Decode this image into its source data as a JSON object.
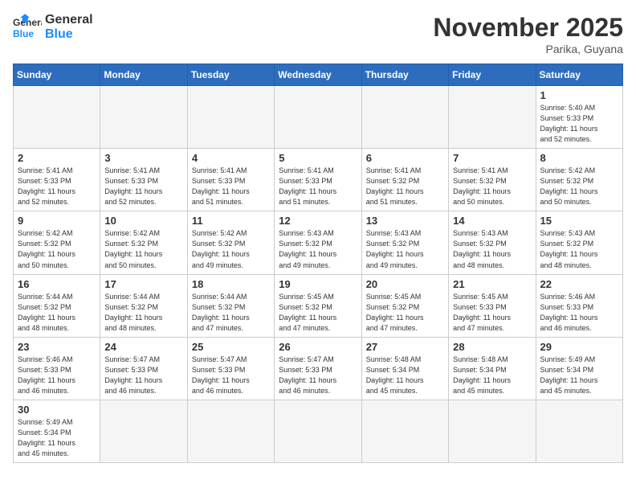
{
  "logo": {
    "general": "General",
    "blue": "Blue"
  },
  "title": "November 2025",
  "location": "Parika, Guyana",
  "days_of_week": [
    "Sunday",
    "Monday",
    "Tuesday",
    "Wednesday",
    "Thursday",
    "Friday",
    "Saturday"
  ],
  "weeks": [
    [
      {
        "day": null,
        "info": null
      },
      {
        "day": null,
        "info": null
      },
      {
        "day": null,
        "info": null
      },
      {
        "day": null,
        "info": null
      },
      {
        "day": null,
        "info": null
      },
      {
        "day": null,
        "info": null
      },
      {
        "day": "1",
        "info": "Sunrise: 5:40 AM\nSunset: 5:33 PM\nDaylight: 11 hours\nand 52 minutes."
      }
    ],
    [
      {
        "day": "2",
        "info": "Sunrise: 5:41 AM\nSunset: 5:33 PM\nDaylight: 11 hours\nand 52 minutes."
      },
      {
        "day": "3",
        "info": "Sunrise: 5:41 AM\nSunset: 5:33 PM\nDaylight: 11 hours\nand 52 minutes."
      },
      {
        "day": "4",
        "info": "Sunrise: 5:41 AM\nSunset: 5:33 PM\nDaylight: 11 hours\nand 51 minutes."
      },
      {
        "day": "5",
        "info": "Sunrise: 5:41 AM\nSunset: 5:33 PM\nDaylight: 11 hours\nand 51 minutes."
      },
      {
        "day": "6",
        "info": "Sunrise: 5:41 AM\nSunset: 5:32 PM\nDaylight: 11 hours\nand 51 minutes."
      },
      {
        "day": "7",
        "info": "Sunrise: 5:41 AM\nSunset: 5:32 PM\nDaylight: 11 hours\nand 50 minutes."
      },
      {
        "day": "8",
        "info": "Sunrise: 5:42 AM\nSunset: 5:32 PM\nDaylight: 11 hours\nand 50 minutes."
      }
    ],
    [
      {
        "day": "9",
        "info": "Sunrise: 5:42 AM\nSunset: 5:32 PM\nDaylight: 11 hours\nand 50 minutes."
      },
      {
        "day": "10",
        "info": "Sunrise: 5:42 AM\nSunset: 5:32 PM\nDaylight: 11 hours\nand 50 minutes."
      },
      {
        "day": "11",
        "info": "Sunrise: 5:42 AM\nSunset: 5:32 PM\nDaylight: 11 hours\nand 49 minutes."
      },
      {
        "day": "12",
        "info": "Sunrise: 5:43 AM\nSunset: 5:32 PM\nDaylight: 11 hours\nand 49 minutes."
      },
      {
        "day": "13",
        "info": "Sunrise: 5:43 AM\nSunset: 5:32 PM\nDaylight: 11 hours\nand 49 minutes."
      },
      {
        "day": "14",
        "info": "Sunrise: 5:43 AM\nSunset: 5:32 PM\nDaylight: 11 hours\nand 48 minutes."
      },
      {
        "day": "15",
        "info": "Sunrise: 5:43 AM\nSunset: 5:32 PM\nDaylight: 11 hours\nand 48 minutes."
      }
    ],
    [
      {
        "day": "16",
        "info": "Sunrise: 5:44 AM\nSunset: 5:32 PM\nDaylight: 11 hours\nand 48 minutes."
      },
      {
        "day": "17",
        "info": "Sunrise: 5:44 AM\nSunset: 5:32 PM\nDaylight: 11 hours\nand 48 minutes."
      },
      {
        "day": "18",
        "info": "Sunrise: 5:44 AM\nSunset: 5:32 PM\nDaylight: 11 hours\nand 47 minutes."
      },
      {
        "day": "19",
        "info": "Sunrise: 5:45 AM\nSunset: 5:32 PM\nDaylight: 11 hours\nand 47 minutes."
      },
      {
        "day": "20",
        "info": "Sunrise: 5:45 AM\nSunset: 5:32 PM\nDaylight: 11 hours\nand 47 minutes."
      },
      {
        "day": "21",
        "info": "Sunrise: 5:45 AM\nSunset: 5:33 PM\nDaylight: 11 hours\nand 47 minutes."
      },
      {
        "day": "22",
        "info": "Sunrise: 5:46 AM\nSunset: 5:33 PM\nDaylight: 11 hours\nand 46 minutes."
      }
    ],
    [
      {
        "day": "23",
        "info": "Sunrise: 5:46 AM\nSunset: 5:33 PM\nDaylight: 11 hours\nand 46 minutes."
      },
      {
        "day": "24",
        "info": "Sunrise: 5:47 AM\nSunset: 5:33 PM\nDaylight: 11 hours\nand 46 minutes."
      },
      {
        "day": "25",
        "info": "Sunrise: 5:47 AM\nSunset: 5:33 PM\nDaylight: 11 hours\nand 46 minutes."
      },
      {
        "day": "26",
        "info": "Sunrise: 5:47 AM\nSunset: 5:33 PM\nDaylight: 11 hours\nand 46 minutes."
      },
      {
        "day": "27",
        "info": "Sunrise: 5:48 AM\nSunset: 5:34 PM\nDaylight: 11 hours\nand 45 minutes."
      },
      {
        "day": "28",
        "info": "Sunrise: 5:48 AM\nSunset: 5:34 PM\nDaylight: 11 hours\nand 45 minutes."
      },
      {
        "day": "29",
        "info": "Sunrise: 5:49 AM\nSunset: 5:34 PM\nDaylight: 11 hours\nand 45 minutes."
      }
    ],
    [
      {
        "day": "30",
        "info": "Sunrise: 5:49 AM\nSunset: 5:34 PM\nDaylight: 11 hours\nand 45 minutes."
      },
      {
        "day": null,
        "info": null
      },
      {
        "day": null,
        "info": null
      },
      {
        "day": null,
        "info": null
      },
      {
        "day": null,
        "info": null
      },
      {
        "day": null,
        "info": null
      },
      {
        "day": null,
        "info": null
      }
    ]
  ]
}
